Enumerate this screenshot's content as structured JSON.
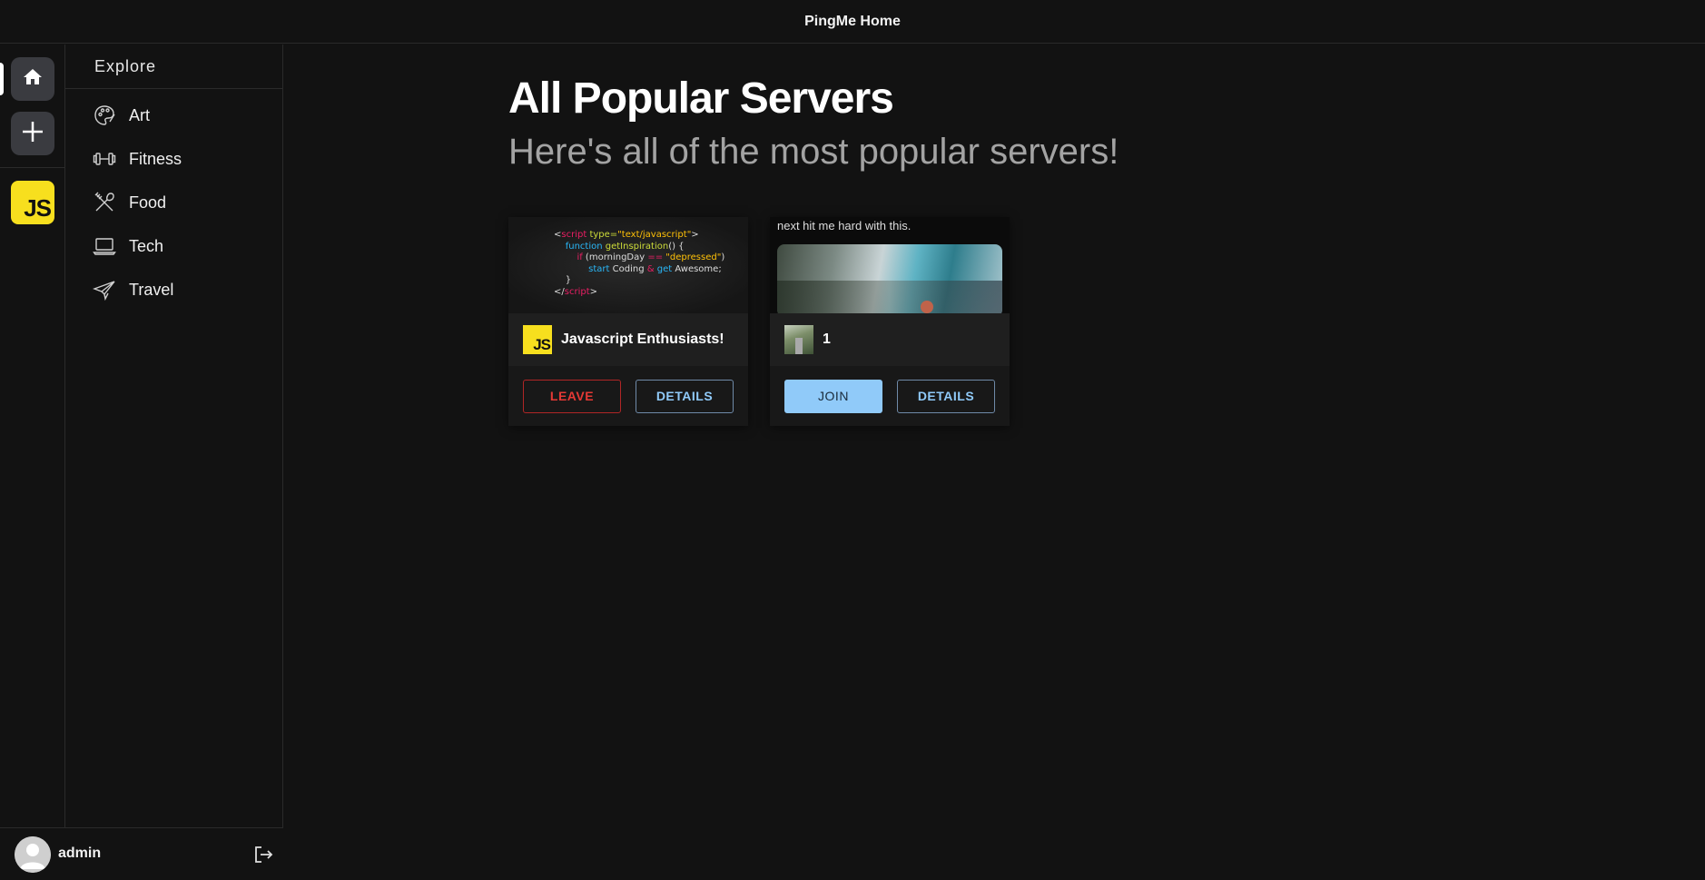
{
  "header": {
    "title": "PingMe Home"
  },
  "rail": {
    "home_icon": "home-icon",
    "add_icon": "plus-icon",
    "servers": [
      {
        "logo_text": "JS",
        "color": "#f7df1e"
      }
    ]
  },
  "sidebar": {
    "heading": "Explore",
    "items": [
      {
        "label": "Art",
        "icon": "palette-icon"
      },
      {
        "label": "Fitness",
        "icon": "dumbbell-icon"
      },
      {
        "label": "Food",
        "icon": "utensils-icon"
      },
      {
        "label": "Tech",
        "icon": "laptop-icon"
      },
      {
        "label": "Travel",
        "icon": "paper-plane-icon"
      }
    ]
  },
  "user": {
    "name": "admin",
    "logout_icon": "logout-icon"
  },
  "main": {
    "title": "All Popular Servers",
    "subtitle": "Here's all of the most popular servers!",
    "cards": [
      {
        "name": "Javascript Enthusiasts!",
        "icon_text": "JS",
        "banner_code": {
          "line1_a": "<",
          "line1_b": "script",
          "line1_c": " type=",
          "line1_d": "\"text/javascript\"",
          "line1_e": ">",
          "line2_a": "function ",
          "line2_b": "getInspiration",
          "line2_c": "() {",
          "line3_a": "if",
          "line3_b": " (morningDay ",
          "line3_c": "==",
          "line3_d": " \"depressed\"",
          "line3_e": ")",
          "line4_a": "start",
          "line4_b": " Coding ",
          "line4_c": "&",
          "line4_d": " get",
          "line4_e": " Awesome;",
          "line5": "}",
          "line6_a": "</",
          "line6_b": "script",
          "line6_c": ">"
        },
        "primary_button": "LEAVE",
        "secondary_button": "DETAILS"
      },
      {
        "name": "1",
        "banner_caption": "next hit me hard with this.",
        "primary_button": "JOIN",
        "secondary_button": "DETAILS"
      }
    ]
  },
  "colors": {
    "background": "#121212",
    "leave": "#e53935",
    "accent": "#90caf9",
    "js_yellow": "#f7df1e"
  }
}
